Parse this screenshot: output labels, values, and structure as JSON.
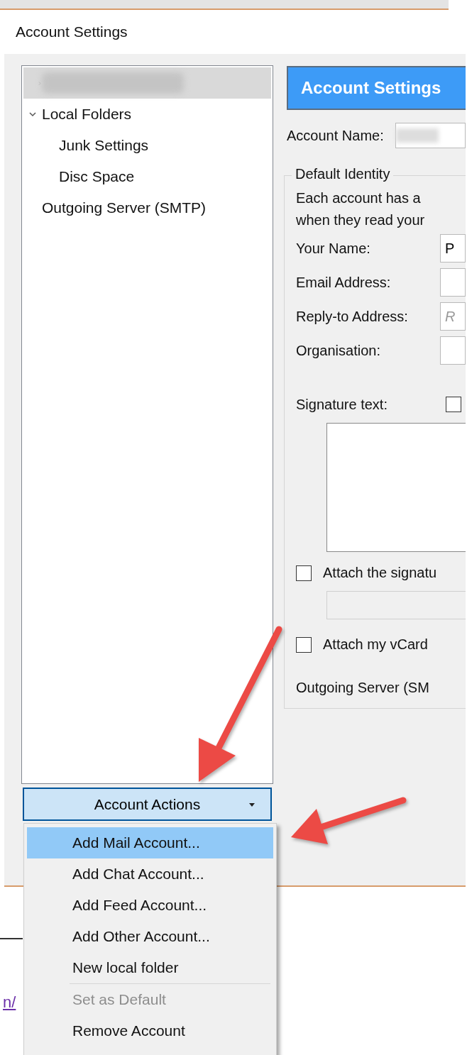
{
  "window": {
    "title": "Account Settings"
  },
  "tree": {
    "items": [
      {
        "kind": "redacted",
        "selected": true,
        "expanded": false
      },
      {
        "kind": "text",
        "label": "Local Folders",
        "selected": false,
        "expanded": true,
        "children": [
          {
            "label": "Junk Settings",
            "selected": false
          },
          {
            "label": "Disc Space",
            "selected": false
          }
        ]
      },
      {
        "kind": "text",
        "label": "Outgoing Server (SMTP)",
        "selected": false
      }
    ]
  },
  "account_actions": {
    "label": "Account Actions",
    "expanded": true
  },
  "menu": {
    "groups": [
      [
        {
          "label": "Add Mail Account...",
          "selected": true,
          "disabled": false
        },
        {
          "label": "Add Chat Account...",
          "selected": false,
          "disabled": false
        },
        {
          "label": "Add Feed Account...",
          "selected": false,
          "disabled": false
        },
        {
          "label": "Add Other Account...",
          "selected": false,
          "disabled": false
        },
        {
          "label": "New local folder",
          "selected": false,
          "disabled": false
        }
      ],
      [
        {
          "label": "Set as Default",
          "selected": false,
          "disabled": true
        },
        {
          "label": "Remove Account",
          "selected": false,
          "disabled": false
        }
      ]
    ]
  },
  "panel": {
    "header": "Account Settings",
    "account_name_label": "Account Name:",
    "default_identity": {
      "legend": "Default Identity",
      "description": [
        "Each account has a",
        "when they read your"
      ],
      "fields": [
        {
          "label": "Your Name:",
          "value": "P"
        },
        {
          "label": "Email Address:"
        },
        {
          "label": "Reply-to Address:",
          "placeholder": "R"
        },
        {
          "label": "Organisation:"
        }
      ],
      "signature": {
        "label": "Signature text:",
        "html_checked": false
      },
      "attach_signature": {
        "label": "Attach the signatu",
        "checked": false
      },
      "attach_vcard": {
        "label": "Attach my vCard",
        "checked": false
      },
      "outgoing_server": {
        "label": "Outgoing Server (SM"
      }
    }
  },
  "background_page": {
    "link": "n/"
  }
}
